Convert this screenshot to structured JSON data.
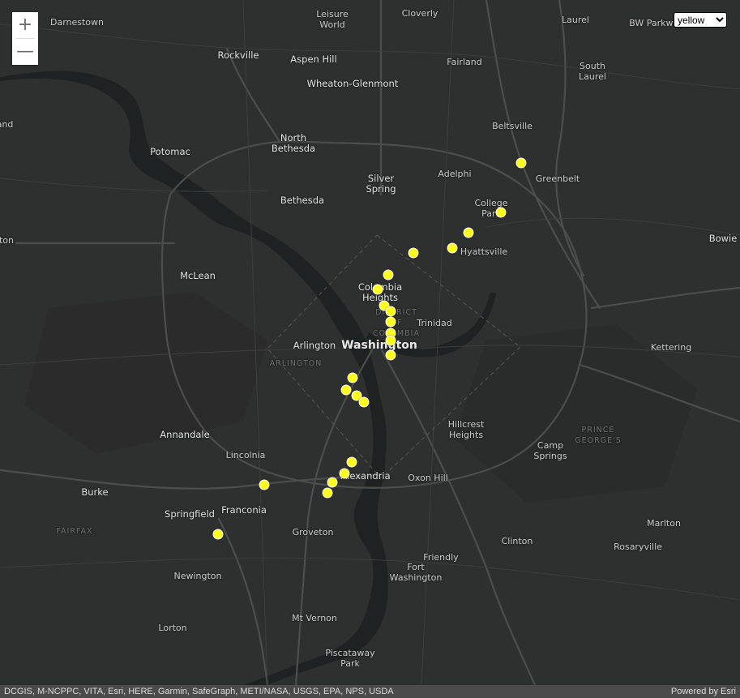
{
  "map": {
    "places": [
      {
        "name": "Darnestown",
        "cls": ""
      },
      {
        "name": "Leisure\nWorld",
        "cls": ""
      },
      {
        "name": "Cloverly",
        "cls": ""
      },
      {
        "name": "Laurel",
        "cls": ""
      },
      {
        "name": "BW Parkway",
        "cls": ""
      },
      {
        "name": "Rockville",
        "cls": "mid"
      },
      {
        "name": "Aspen Hill",
        "cls": "mid"
      },
      {
        "name": "Fairland",
        "cls": ""
      },
      {
        "name": "South\nLaurel",
        "cls": ""
      },
      {
        "name": "Wheaton-Glenmont",
        "cls": "mid"
      },
      {
        "name": "and",
        "cls": ""
      },
      {
        "name": "Beltsville",
        "cls": ""
      },
      {
        "name": "North\nBethesda",
        "cls": "mid"
      },
      {
        "name": "Potomac",
        "cls": "mid"
      },
      {
        "name": "Adelphi",
        "cls": ""
      },
      {
        "name": "Greenbelt",
        "cls": ""
      },
      {
        "name": "Silver\nSpring",
        "cls": "mid"
      },
      {
        "name": "Bethesda",
        "cls": "mid"
      },
      {
        "name": "College\nPark",
        "cls": ""
      },
      {
        "name": "ton",
        "cls": ""
      },
      {
        "name": "Bowie",
        "cls": "mid"
      },
      {
        "name": "Hyattsville",
        "cls": ""
      },
      {
        "name": "McLean",
        "cls": "mid"
      },
      {
        "name": "Columbia\nHeights",
        "cls": "mid"
      },
      {
        "name": "DISTRICT\nOF\nCOLUMBIA",
        "cls": "region"
      },
      {
        "name": "Trinidad",
        "cls": ""
      },
      {
        "name": "Arlington",
        "cls": "mid"
      },
      {
        "name": "Washington",
        "cls": "big"
      },
      {
        "name": "ARLINGTON",
        "cls": "region"
      },
      {
        "name": "Kettering",
        "cls": ""
      },
      {
        "name": "Hillcrest\nHeights",
        "cls": ""
      },
      {
        "name": "PRINCE\nGEORGE'S",
        "cls": "region"
      },
      {
        "name": "Annandale",
        "cls": "mid"
      },
      {
        "name": "Camp\nSprings",
        "cls": ""
      },
      {
        "name": "Lincolnia",
        "cls": ""
      },
      {
        "name": "Alexandria",
        "cls": "mid"
      },
      {
        "name": "Oxon Hill",
        "cls": ""
      },
      {
        "name": "Burke",
        "cls": "mid"
      },
      {
        "name": "Springfield",
        "cls": "mid"
      },
      {
        "name": "Franconia",
        "cls": "mid"
      },
      {
        "name": "FAIRFAX",
        "cls": "region"
      },
      {
        "name": "Groveton",
        "cls": ""
      },
      {
        "name": "Marlton",
        "cls": ""
      },
      {
        "name": "Clinton",
        "cls": ""
      },
      {
        "name": "Rosaryville",
        "cls": ""
      },
      {
        "name": "Friendly",
        "cls": ""
      },
      {
        "name": "Fort\nWashington",
        "cls": ""
      },
      {
        "name": "Newington",
        "cls": ""
      },
      {
        "name": "Mt Vernon",
        "cls": ""
      },
      {
        "name": "Lorton",
        "cls": ""
      },
      {
        "name": "Piscataway\nPark",
        "cls": ""
      }
    ],
    "marker_color": "#ffff1c",
    "markers": [
      {
        "id": "greenbelt"
      },
      {
        "id": "college-park"
      },
      {
        "id": "riverdale"
      },
      {
        "id": "hyattsville"
      },
      {
        "id": "fort-totten"
      },
      {
        "id": "georgia-ave"
      },
      {
        "id": "columbia-heights"
      },
      {
        "id": "shaw-1"
      },
      {
        "id": "shaw-2"
      },
      {
        "id": "mt-vernon-sq-1"
      },
      {
        "id": "mt-vernon-sq-2"
      },
      {
        "id": "gallery-place"
      },
      {
        "id": "judiciary"
      },
      {
        "id": "pentagon-city"
      },
      {
        "id": "crystal-city-1"
      },
      {
        "id": "crystal-city-2"
      },
      {
        "id": "airport"
      },
      {
        "id": "braddock-1"
      },
      {
        "id": "braddock-2"
      },
      {
        "id": "king-st"
      },
      {
        "id": "eisenhower"
      },
      {
        "id": "van-dorn"
      },
      {
        "id": "franconia-springfield"
      }
    ]
  },
  "zoom": {
    "in_label": "+",
    "out_label": "—"
  },
  "color_select": {
    "selected": "yellow",
    "options": [
      "yellow"
    ]
  },
  "attribution": {
    "text": "DCGIS, M-NCPPC, VITA, Esri, HERE, Garmin, SafeGraph, METI/NASA, USGS, EPA, NPS, USDA",
    "powered": "Powered by Esri"
  }
}
